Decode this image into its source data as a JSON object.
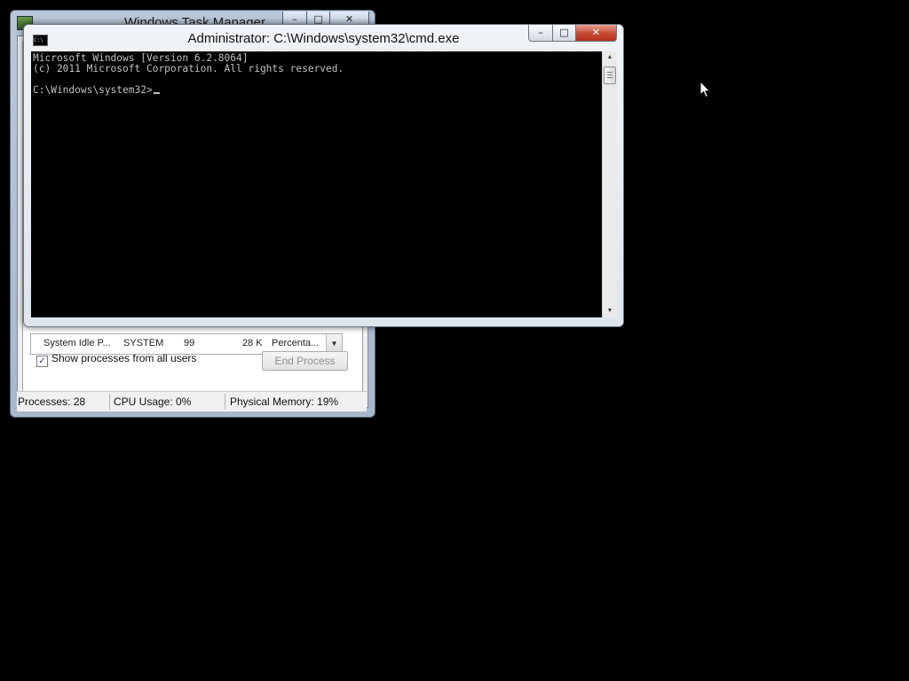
{
  "task_manager": {
    "title": "Windows Task Manager",
    "controls": {
      "minimize": "–",
      "maximize": "□",
      "close": "✕"
    },
    "process_row": {
      "name": "System Idle P...",
      "user": "SYSTEM",
      "cpu": "99",
      "memory": "28 K",
      "description": "Percenta..."
    },
    "show_all_label": "Show processes from all users",
    "show_all_checked": "✓",
    "end_process_label": "End Process",
    "status": {
      "processes": "Processes: 28",
      "cpu": "CPU Usage: 0%",
      "memory": "Physical Memory: 19%"
    }
  },
  "cmd": {
    "title": "Administrator: C:\\Windows\\system32\\cmd.exe",
    "icon_text": "C:\\",
    "controls": {
      "minimize": "–",
      "maximize": "□",
      "close": "✕"
    },
    "lines": [
      "Microsoft Windows [Version 6.2.8064]",
      "(c) 2011 Microsoft Corporation. All rights reserved.",
      "C:\\Windows\\system32>"
    ],
    "scroll_up": "▲",
    "scroll_down": "▼"
  },
  "icons": {
    "pointer": "mouse-pointer-icon",
    "checkbox": "checkmark-icon"
  },
  "colors": {
    "desktop": "#000000",
    "console_bg": "#000000",
    "console_text": "#c0c0c0",
    "close_button": "#c34a32"
  }
}
